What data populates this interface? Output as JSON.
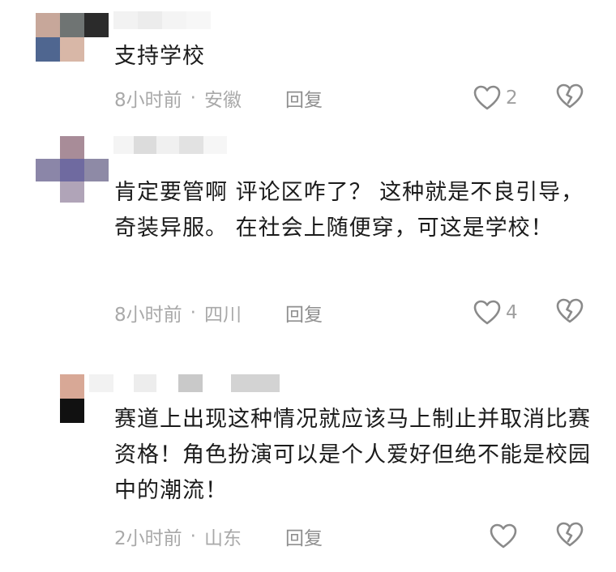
{
  "comments": [
    {
      "text": "支持学校",
      "time": "8小时前",
      "location": "安徽",
      "reply_label": "回复",
      "likes": "2"
    },
    {
      "text": "肯定要管啊 评论区咋了？ 这种就是不良引导，奇装异服。 在社会上随便穿，可这是学校！",
      "time": "8小时前",
      "location": "四川",
      "reply_label": "回复",
      "likes": "4"
    },
    {
      "text": "赛道上出现这种情况就应该马上制止并取消比赛资格！角色扮演可以是个人爱好但绝不能是校园中的潮流！",
      "time": "2小时前",
      "location": "山东",
      "reply_label": "回复",
      "likes": ""
    }
  ],
  "separator": "·",
  "icons": {
    "like": "heart-outline-icon",
    "dislike": "broken-heart-icon"
  },
  "colors": {
    "text": "#1b1b1b",
    "meta": "#a9a9a9",
    "icon": "#8a8a8a"
  }
}
